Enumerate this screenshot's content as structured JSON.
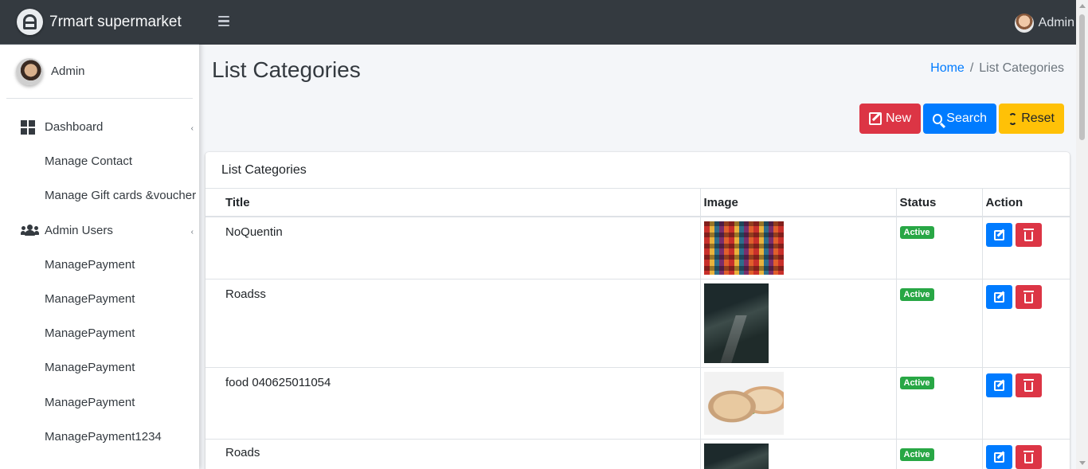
{
  "brand": {
    "name": "7rmart supermarket"
  },
  "topbar": {
    "user_name": "Admin"
  },
  "sidebar": {
    "user_name": "Admin",
    "items": [
      {
        "label": "Dashboard",
        "icon": "dashboard-icon",
        "level": "top"
      },
      {
        "label": "Manage Contact",
        "level": "sub"
      },
      {
        "label": "Manage Gift cards &voucher",
        "level": "sub"
      },
      {
        "label": "Admin Users",
        "icon": "users-icon",
        "level": "top"
      },
      {
        "label": "ManagePayment",
        "level": "sub"
      },
      {
        "label": "ManagePayment",
        "level": "sub"
      },
      {
        "label": "ManagePayment",
        "level": "sub"
      },
      {
        "label": "ManagePayment",
        "level": "sub"
      },
      {
        "label": "ManagePayment",
        "level": "sub"
      },
      {
        "label": "ManagePayment1234",
        "level": "sub"
      }
    ]
  },
  "page": {
    "title": "List Categories"
  },
  "breadcrumb": {
    "home": "Home",
    "separator": "/",
    "current": "List Categories"
  },
  "toolbar": {
    "new_label": "New",
    "search_label": "Search",
    "reset_label": "Reset"
  },
  "card": {
    "title": "List Categories",
    "columns": [
      "Title",
      "Image",
      "Status",
      "Action"
    ],
    "rows": [
      {
        "title": "NoQuentin",
        "image": "lanterns-image",
        "status": "Active"
      },
      {
        "title": "Roadss",
        "image": "forest-road-image",
        "status": "Active"
      },
      {
        "title": "food 040625011054",
        "image": "wrap-food-image",
        "status": "Active"
      },
      {
        "title": "Roads",
        "image": "forest-road-image",
        "status": "Active"
      }
    ]
  },
  "colors": {
    "navbar": "#343a40",
    "primary": "#007bff",
    "danger": "#dc3545",
    "warning": "#ffc107",
    "success": "#28a745"
  }
}
